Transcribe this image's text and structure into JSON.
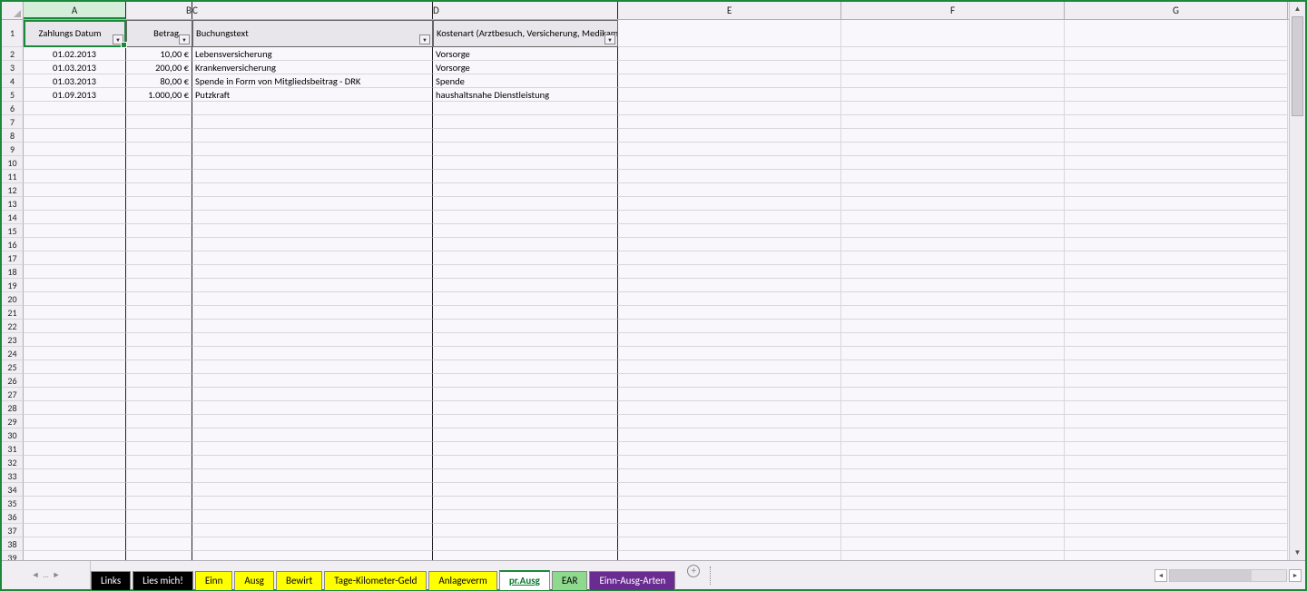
{
  "columns": [
    "A",
    "B",
    "C",
    "D",
    "E",
    "F",
    "G"
  ],
  "rowcount": 39,
  "headers": {
    "A": "Zahlungs Datum",
    "B": "Betrag",
    "C": "Buchungstext",
    "D": "Kostenart (Arztbesuch, Versicherung, Medikamente,"
  },
  "data": [
    {
      "A": "01.02.2013",
      "B": "10,00 €",
      "C": "Lebensversicherung",
      "D": "Vorsorge"
    },
    {
      "A": "01.03.2013",
      "B": "200,00 €",
      "C": "Krankenversicherung",
      "D": "Vorsorge"
    },
    {
      "A": "01.03.2013",
      "B": "80,00 €",
      "C": "Spende in Form von Mitgliedsbeitrag - DRK",
      "D": "Spende"
    },
    {
      "A": "01.09.2013",
      "B": "1.000,00 €",
      "C": "Putzkraft",
      "D": "haushaltsnahe Dienstleistung"
    }
  ],
  "tabs": [
    {
      "label": "Links",
      "cls": "black"
    },
    {
      "label": "Lies mich!",
      "cls": "black"
    },
    {
      "label": "Einn",
      "cls": "yellow"
    },
    {
      "label": "Ausg",
      "cls": "yellow"
    },
    {
      "label": "Bewirt",
      "cls": "yellow"
    },
    {
      "label": "Tage-Kilometer-Geld",
      "cls": "yellow"
    },
    {
      "label": "Anlageverm",
      "cls": "yellow"
    },
    {
      "label": "pr.Ausg",
      "cls": "active"
    },
    {
      "label": "EAR",
      "cls": "green"
    },
    {
      "label": "Einn-Ausg-Arten",
      "cls": "purple"
    }
  ],
  "active_column": "A"
}
